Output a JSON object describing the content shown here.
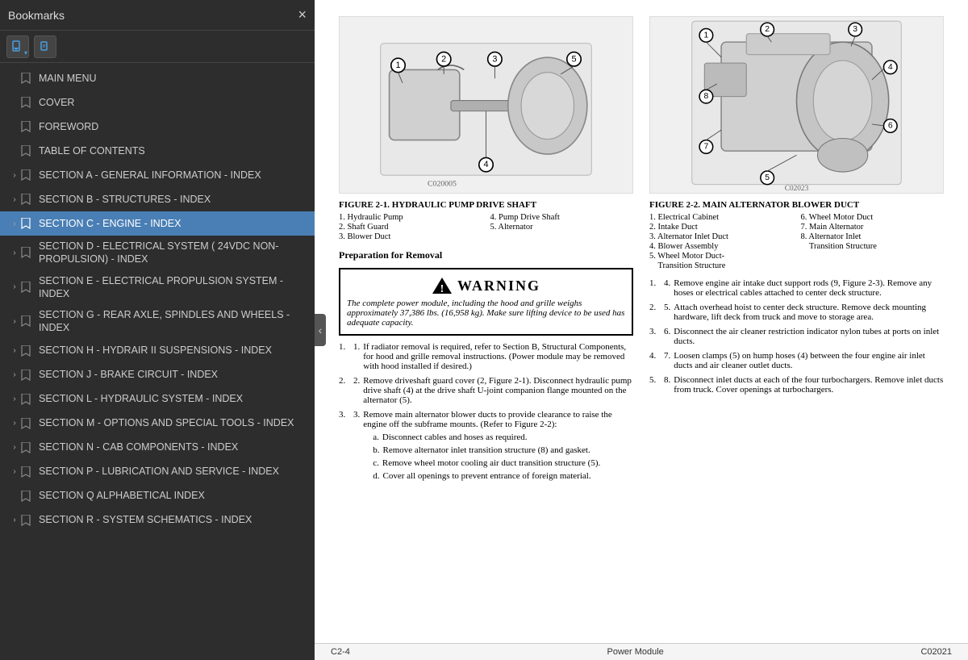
{
  "sidebar": {
    "title": "Bookmarks",
    "close_label": "×",
    "toolbar": {
      "bookmark_icon": "🔖",
      "expand_icon": "📑"
    },
    "items": [
      {
        "id": "main-menu",
        "label": "MAIN MENU",
        "hasExpand": false,
        "active": false
      },
      {
        "id": "cover",
        "label": "COVER",
        "hasExpand": false,
        "active": false
      },
      {
        "id": "foreword",
        "label": "FOREWORD",
        "hasExpand": false,
        "active": false
      },
      {
        "id": "toc",
        "label": "TABLE OF CONTENTS",
        "hasExpand": false,
        "active": false
      },
      {
        "id": "section-a",
        "label": "SECTION A - GENERAL INFORMATION - INDEX",
        "hasExpand": true,
        "active": false
      },
      {
        "id": "section-b",
        "label": "SECTION B - STRUCTURES - INDEX",
        "hasExpand": true,
        "active": false
      },
      {
        "id": "section-c",
        "label": "SECTION C - ENGINE - INDEX",
        "hasExpand": true,
        "active": true
      },
      {
        "id": "section-d",
        "label": "SECTION D - ELECTRICAL SYSTEM ( 24VDC NON-PROPULSION) - INDEX",
        "hasExpand": true,
        "active": false
      },
      {
        "id": "section-e",
        "label": "SECTION E - ELECTRICAL PROPULSION SYSTEM - INDEX",
        "hasExpand": true,
        "active": false
      },
      {
        "id": "section-g",
        "label": "SECTION G - REAR AXLE, SPINDLES AND WHEELS - INDEX",
        "hasExpand": true,
        "active": false
      },
      {
        "id": "section-h",
        "label": "SECTION H - HYDRAIR II SUSPENSIONS - INDEX",
        "hasExpand": true,
        "active": false
      },
      {
        "id": "section-j",
        "label": "SECTION J  - BRAKE CIRCUIT - INDEX",
        "hasExpand": true,
        "active": false
      },
      {
        "id": "section-l",
        "label": "SECTION L - HYDRAULIC SYSTEM - INDEX",
        "hasExpand": true,
        "active": false
      },
      {
        "id": "section-m",
        "label": "SECTION M - OPTIONS AND SPECIAL TOOLS - INDEX",
        "hasExpand": true,
        "active": false
      },
      {
        "id": "section-n",
        "label": "SECTION N - CAB COMPONENTS - INDEX",
        "hasExpand": true,
        "active": false
      },
      {
        "id": "section-p",
        "label": "SECTION P - LUBRICATION AND SERVICE - INDEX",
        "hasExpand": true,
        "active": false
      },
      {
        "id": "section-q",
        "label": "SECTION Q ALPHABETICAL INDEX",
        "hasExpand": false,
        "active": false
      },
      {
        "id": "section-r",
        "label": "SECTION R - SYSTEM SCHEMATICS - INDEX",
        "hasExpand": true,
        "active": false
      }
    ]
  },
  "doc": {
    "figure1": {
      "caption": "FIGURE 2-1. HYDRAULIC PUMP DRIVE SHAFT",
      "items": [
        "1. Hydraulic Pump",
        "4. Pump Drive Shaft",
        "2. Shaft Guard",
        "5. Alternator",
        "3. Blower Duct",
        ""
      ],
      "code": "C020005"
    },
    "figure2": {
      "caption": "FIGURE 2-2. MAIN ALTERNATOR BLOWER DUCT",
      "items": [
        "1. Electrical Cabinet",
        "6. Wheel Motor Duct",
        "2. Intake Duct",
        "7. Main Alternator",
        "3. Alternator Inlet Duct",
        "8. Alternator Inlet",
        "4. Blower Assembly",
        "    Transition Structure",
        "5. Wheel Motor Duct-",
        "",
        "    Transition Structure",
        ""
      ],
      "code": "C02023"
    },
    "section_heading": "Preparation for Removal",
    "warning": {
      "header": "WARNING",
      "text": "The complete power module, including the hood and grille weighs approximately 37,386 lbs. (16,958 kg). Make sure lifting device to be used has adequate capacity."
    },
    "steps": [
      {
        "text": "If radiator removal is required, refer to Section B, Structural Components, for hood and grille removal instructions. (Power module may be removed with hood installed if desired.)",
        "substeps": []
      },
      {
        "text": "Remove driveshaft guard cover (2, Figure 2-1). Disconnect hydraulic pump drive shaft (4) at the drive shaft U-joint companion flange mounted on the alternator (5).",
        "substeps": []
      },
      {
        "text": "Remove main alternator blower ducts to provide clearance to raise the engine off the subframe mounts. (Refer to Figure 2-2):",
        "substeps": [
          "a.  Disconnect cables and hoses as required.",
          "b.  Remove alternator inlet transition structure (8) and gasket.",
          "c.  Remove wheel motor cooling air duct transition structure (5).",
          "d.  Cover all openings to prevent entrance of foreign material."
        ]
      }
    ],
    "right_steps": [
      "4.  Remove engine air intake duct support rods (9, Figure 2-3). Remove any hoses or electrical cables attached to center deck structure.",
      "5.  Attach overhead hoist to center deck structure. Remove deck mounting hardware, lift deck from truck and move to storage area.",
      "6.  Disconnect the air cleaner restriction indicator nylon tubes at ports on inlet ducts.",
      "7.  Loosen clamps (5) on hump hoses (4) between the four engine air inlet ducts and air cleaner outlet ducts.",
      "8.  Disconnect inlet ducts at each of the four turbochargers. Remove inlet ducts from truck. Cover openings at turbochargers."
    ],
    "footer": {
      "left": "C2-4",
      "center": "Power Module",
      "right": "C02021"
    }
  },
  "icons": {
    "bookmark": "🔖",
    "expand_right": "›",
    "collapse_left": "‹",
    "warning_symbol": "⚠"
  }
}
